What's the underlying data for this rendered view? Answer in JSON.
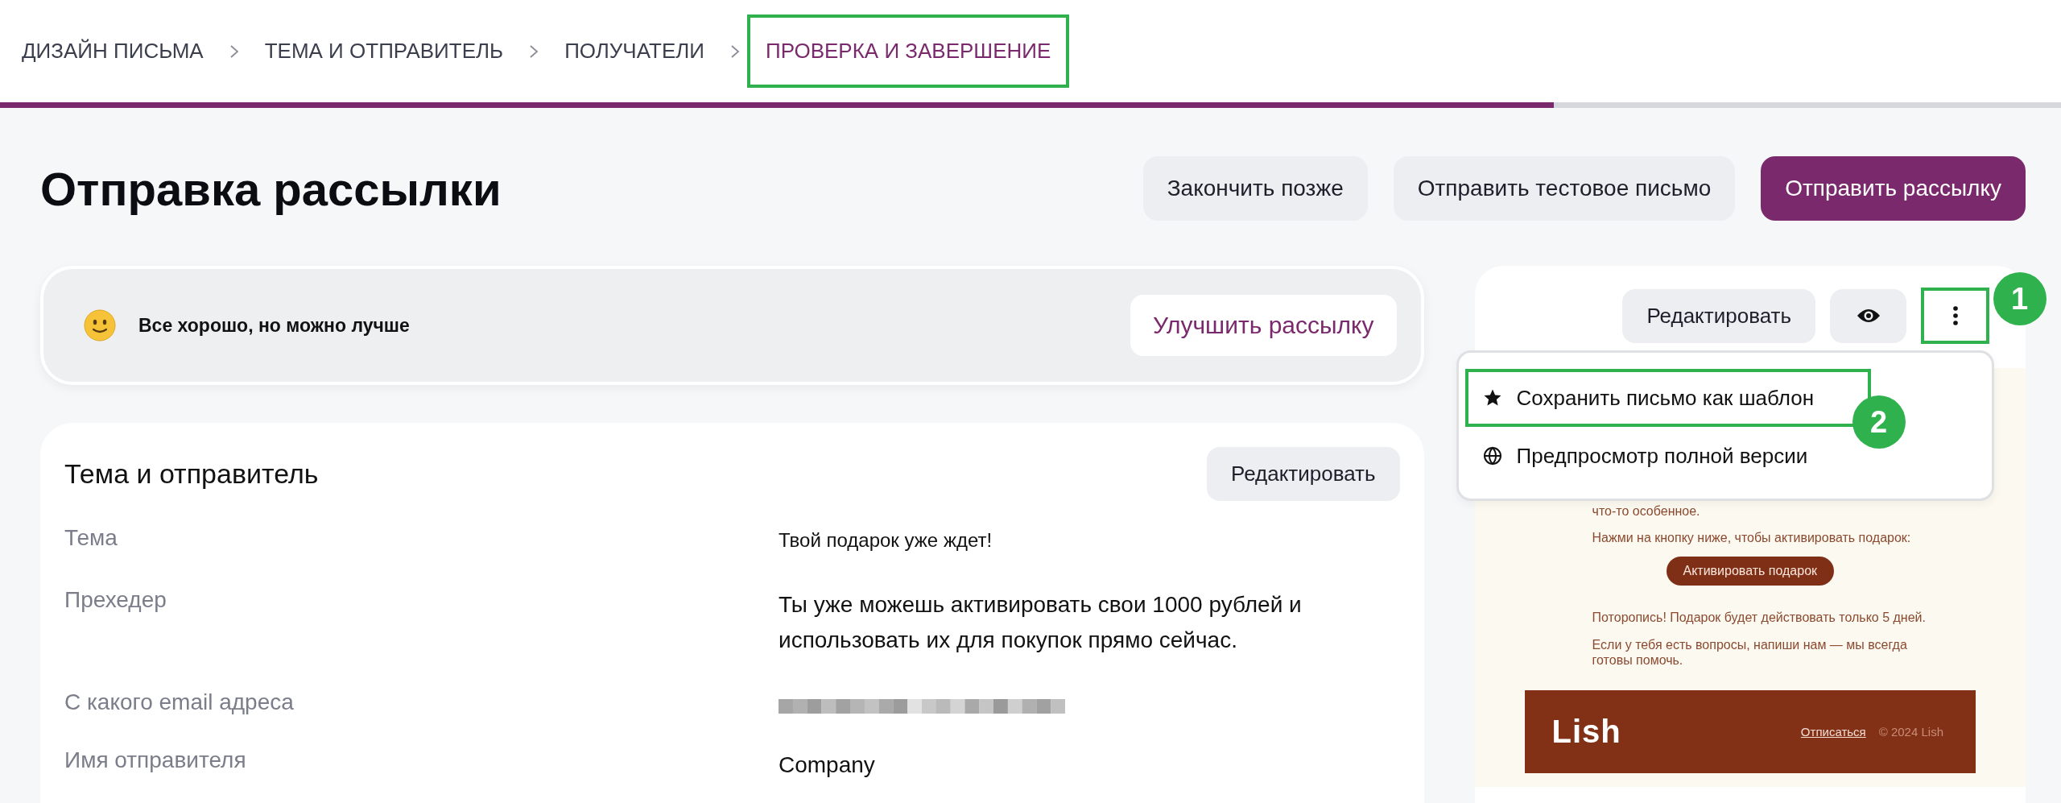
{
  "breadcrumb": [
    {
      "label": "ДИЗАЙН ПИСЬМА",
      "selected": false,
      "highlighted": false
    },
    {
      "label": "ТЕМА И ОТПРАВИТЕЛЬ",
      "selected": false,
      "highlighted": false
    },
    {
      "label": "ПОЛУЧАТЕЛИ",
      "selected": false,
      "highlighted": false
    },
    {
      "label": "ПРОВЕРКА И ЗАВЕРШЕНИЕ",
      "selected": true,
      "highlighted": true
    }
  ],
  "progress": {
    "level": 0.754
  },
  "page_title": "Отправка рассылки",
  "actions": [
    {
      "label": "Закончить позже",
      "kind": "secondary"
    },
    {
      "label": "Отправить тестовое письмо",
      "kind": "secondary"
    },
    {
      "label": "Отправить рассылку",
      "kind": "primary"
    }
  ],
  "alert": {
    "message": "Все хорошо, но можно лучше",
    "button": "Улучшить рассылку"
  },
  "subject_card": {
    "title": "Тема и отправитель",
    "edit_button": "Редактировать",
    "rows": [
      {
        "label": "Тема",
        "value": "Твой подарок уже ждет!",
        "kind": "small"
      },
      {
        "label": "Прехедер",
        "value": "Ты уже можешь активировать свои 1000 рублей и использовать их для покупок прямо сейчас.",
        "kind": "text"
      },
      {
        "label": "С какого email адреса",
        "kind": "redacted"
      },
      {
        "label": "Имя отправителя",
        "value": "Company",
        "kind": "text"
      }
    ]
  },
  "preview": {
    "edit_button": "Редактировать",
    "more_highlighted": true,
    "more_badge": "1",
    "menu": [
      {
        "label": "Сохранить письмо как шаблон",
        "kind": "star",
        "highlighted": true,
        "badge": "2"
      },
      {
        "label": "Предпросмотр полной версии",
        "kind": "globe",
        "highlighted": false
      }
    ],
    "email": {
      "paragraphs_before": [
        "что-то особенное.",
        "Нажми на кнопку ниже, чтобы активировать подарок:"
      ],
      "button": "Активировать подарок",
      "paragraphs_after": [
        "Поторопись! Подарок будет действовать только 5 дней.",
        "Если у тебя есть вопросы, напиши нам — мы всегда готовы помочь."
      ],
      "footer": {
        "logo": "Lish",
        "unsubscribe": "Отписаться",
        "copyright": "© 2024 Lish"
      }
    }
  }
}
